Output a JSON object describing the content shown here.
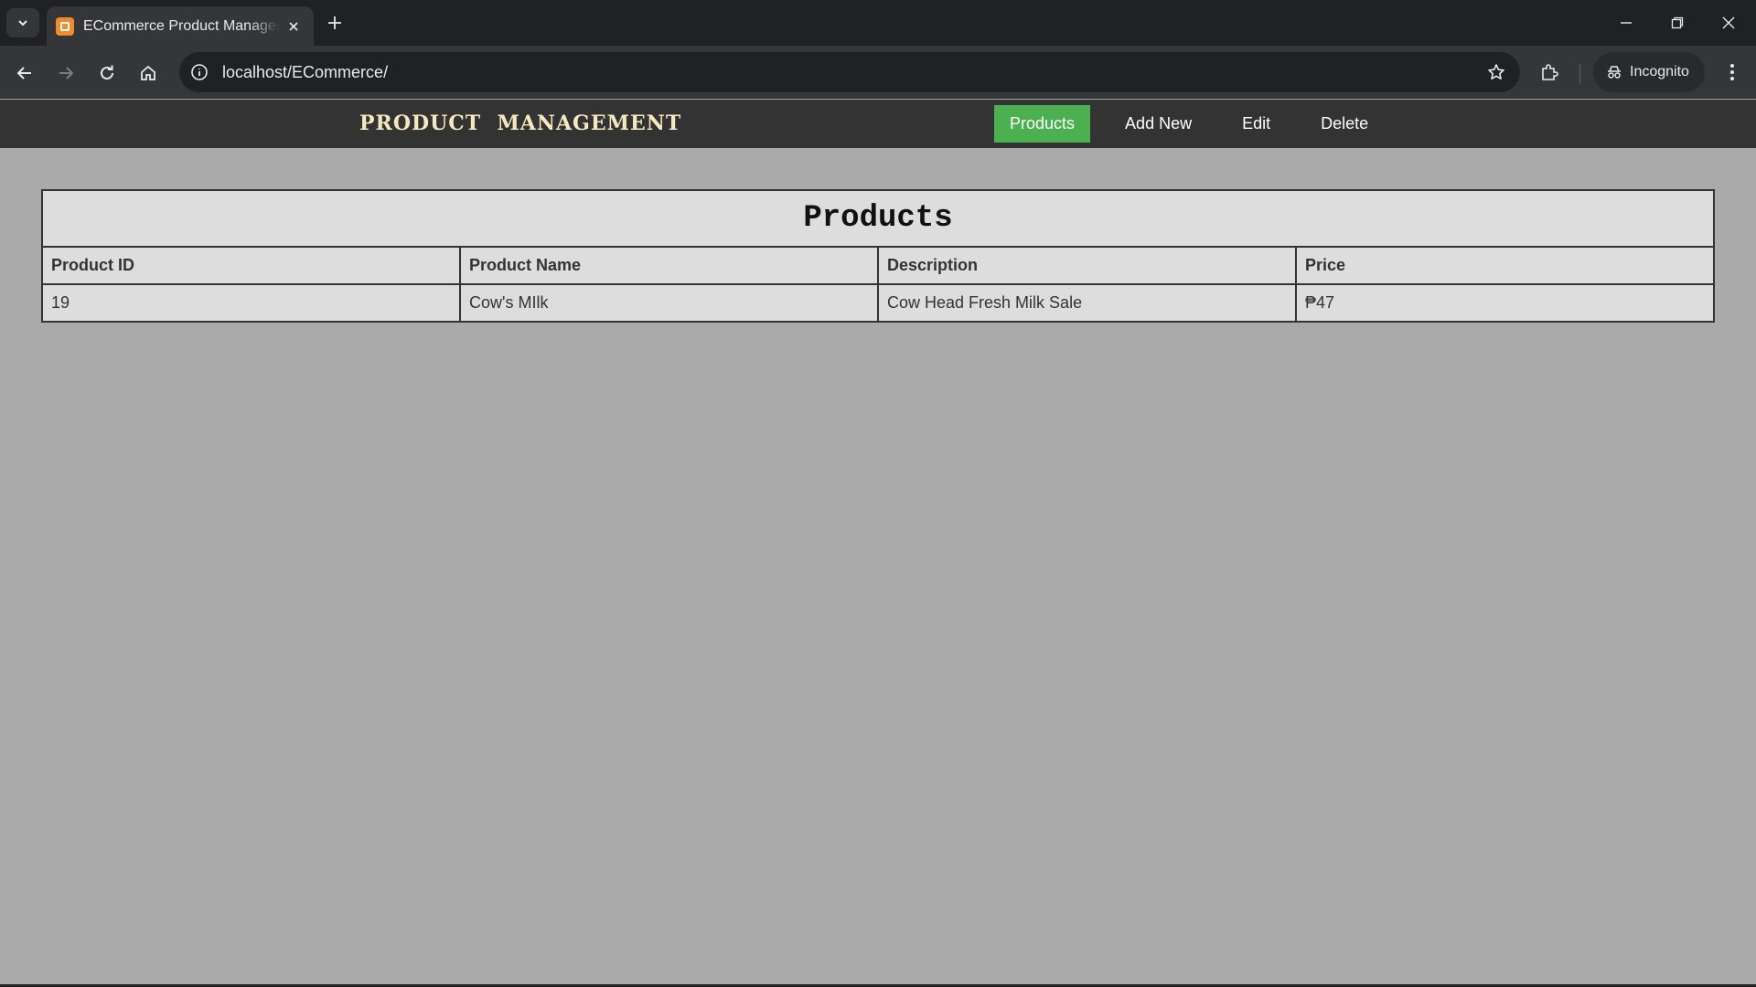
{
  "browser": {
    "tab_title": "ECommerce Product Management",
    "url": "localhost/ECommerce/",
    "incognito_label": "Incognito"
  },
  "header": {
    "brand": "PRODUCT  MANAGEMENT",
    "nav": [
      {
        "label": "Products",
        "active": true
      },
      {
        "label": "Add New",
        "active": false
      },
      {
        "label": "Edit",
        "active": false
      },
      {
        "label": "Delete",
        "active": false
      }
    ]
  },
  "products_table": {
    "caption": "Products",
    "columns": [
      "Product ID",
      "Product Name",
      "Description",
      "Price"
    ],
    "rows": [
      [
        "19",
        "Cow's MIlk",
        "Cow Head Fresh Milk Sale",
        "₱47"
      ]
    ]
  },
  "colors": {
    "active_nav": "#4caf50",
    "header_bg": "#333333",
    "page_bg": "#aaaaaa",
    "table_bg": "#dddddd"
  }
}
